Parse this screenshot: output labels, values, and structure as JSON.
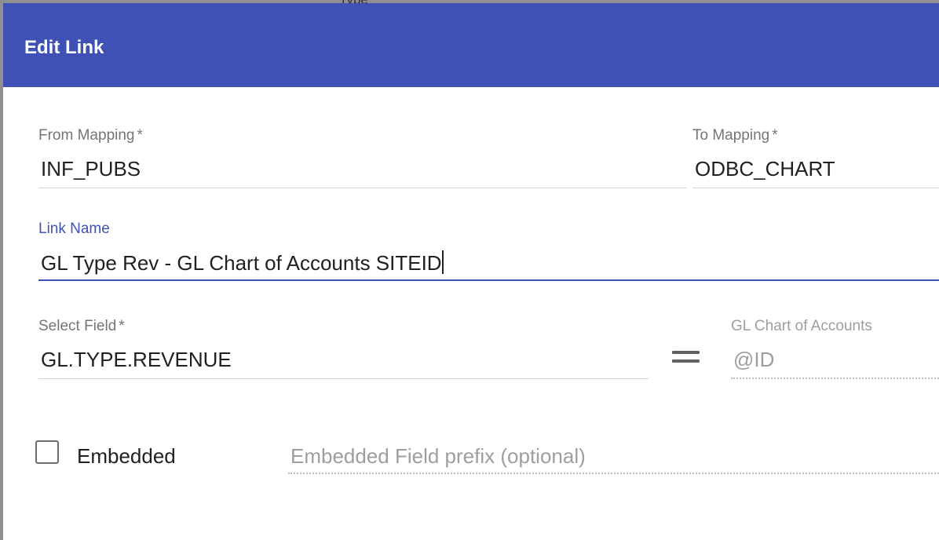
{
  "background": {
    "peek_text": "Type"
  },
  "dialog": {
    "title": "Edit Link",
    "header_color": "#3f51b5"
  },
  "from_mapping": {
    "label": "From Mapping",
    "required_mark": "*",
    "value": "INF_PUBS"
  },
  "to_mapping": {
    "label": "To Mapping",
    "required_mark": "*",
    "value": "ODBC_CHART"
  },
  "link_name": {
    "label": "Link Name",
    "value": "GL Type Rev - GL Chart of Accounts SITEID",
    "focused": true
  },
  "select_field": {
    "label": "Select Field",
    "required_mark": "*",
    "value": "GL.TYPE.REVENUE"
  },
  "equals_icon": "equals-icon",
  "target_field": {
    "label": "GL Chart of Accounts",
    "value": "@ID",
    "disabled": true
  },
  "embedded": {
    "label": "Embedded",
    "checked": false
  },
  "embedded_prefix": {
    "placeholder": "Embedded Field prefix (optional)",
    "value": ""
  }
}
